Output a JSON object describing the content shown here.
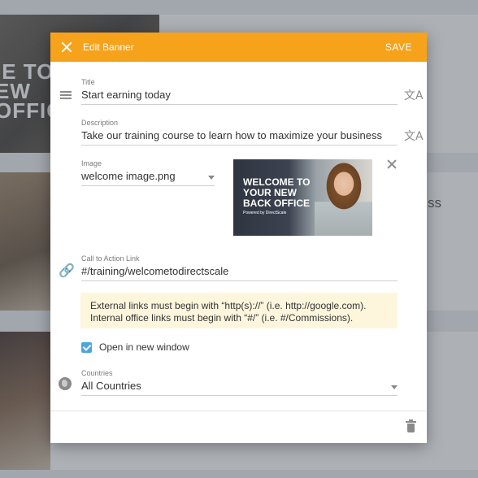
{
  "background": {
    "hero_text_lines": [
      "IE TO",
      "EW",
      "OFFICE"
    ],
    "side_text": "ss"
  },
  "modal": {
    "title": "Edit Banner",
    "save_label": "SAVE",
    "title_field": {
      "label": "Title",
      "value": "Start earning today"
    },
    "description_field": {
      "label": "Description",
      "value": "Take our training course to learn how to maximize your business"
    },
    "image_field": {
      "label": "Image",
      "value": "welcome image.png"
    },
    "banner_preview": {
      "line1": "WELCOME TO",
      "line2": "YOUR NEW",
      "line3": "BACK OFFICE",
      "tagline": "Powered by DirectScale"
    },
    "cta_field": {
      "label": "Call to Action Link",
      "value": "#/training/welcometodirectscale"
    },
    "notice": {
      "line1": "External links must begin with “http(s)://” (i.e. http://google.com).",
      "line2": "Internal  office links must begin with “#/” (i.e. #/Commissions)."
    },
    "open_new_window": {
      "label": "Open in new window",
      "checked": true
    },
    "countries_field": {
      "label": "Countries",
      "value": "All Countries"
    }
  },
  "icons": {
    "translate": "文A",
    "link": "🔗"
  },
  "colors": {
    "header": "#f7a21b",
    "checkbox": "#4ba6e0",
    "notice_bg": "#fdf6dd"
  }
}
